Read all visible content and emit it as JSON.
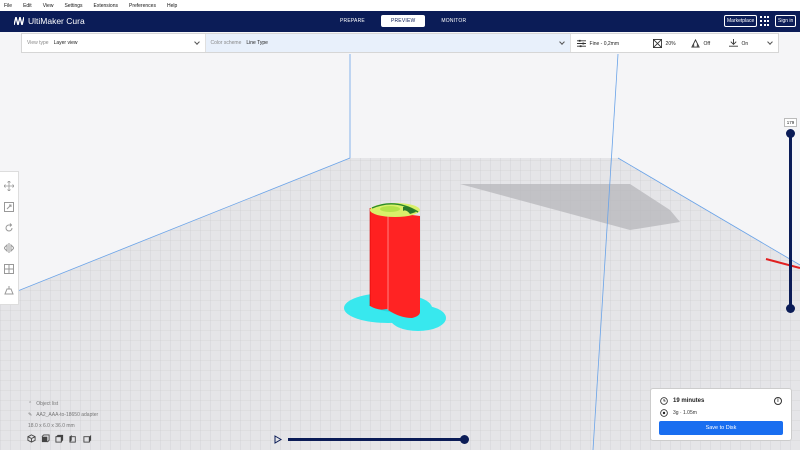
{
  "menubar": [
    "File",
    "Edit",
    "View",
    "Settings",
    "Extensions",
    "Preferences",
    "Help"
  ],
  "header": {
    "app_title": "UltiMaker Cura",
    "stages": [
      {
        "label": "PREPARE",
        "active": false
      },
      {
        "label": "PREVIEW",
        "active": true
      },
      {
        "label": "MONITOR",
        "active": false
      }
    ],
    "marketplace": "Marketplace",
    "sign_in": "Sign in",
    "brand_color": "#0b1c57"
  },
  "toolbar": {
    "view_type_label": "View type",
    "view_type_value": "Layer view",
    "color_scheme_label": "Color scheme",
    "color_scheme_value": "Line Type",
    "profile": "Fine - 0,2mm",
    "infill": "20%",
    "support": "Off",
    "adhesion": "On"
  },
  "tools": [
    "move-icon",
    "scale-icon",
    "rotate-icon",
    "mirror-icon",
    "per-model-settings-icon",
    "support-blocker-icon"
  ],
  "layer_slider": {
    "current_layer": "179",
    "position_fraction": 1.0
  },
  "object_info": {
    "object_list": "Object list",
    "filename": "AA2_AAA-to-18650 adapter",
    "dimensions": "18.0 x 6.0 x 36.0 mm"
  },
  "print": {
    "time": "19 minutes",
    "material": "3g · 1.05m",
    "save_label": "Save to Disk",
    "accent_color": "#196ef0"
  },
  "model_colors": {
    "wall": "#ff2020",
    "skirt": "#38e8ee",
    "top": "#b3e34a"
  }
}
